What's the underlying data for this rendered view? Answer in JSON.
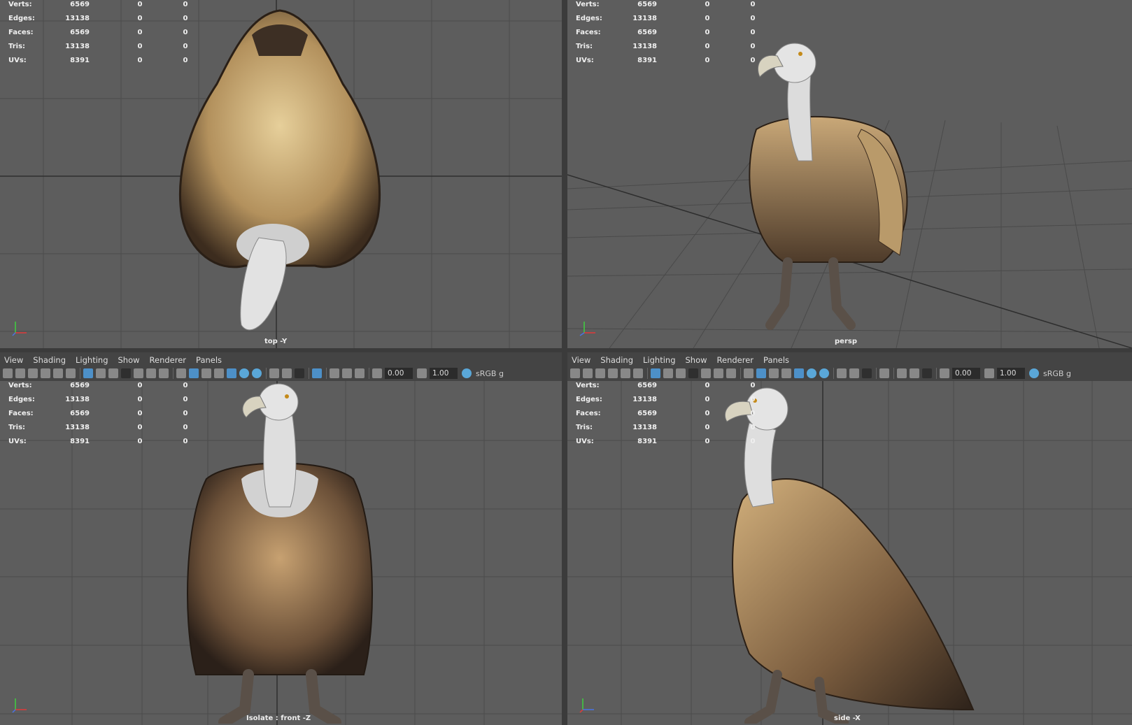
{
  "panes": [
    {
      "id": "top",
      "camera_label": "top -Y",
      "stats": [
        {
          "label": "Verts:",
          "values": [
            "6569",
            "0",
            "0"
          ]
        },
        {
          "label": "Edges:",
          "values": [
            "13138",
            "0",
            "0"
          ]
        },
        {
          "label": "Faces:",
          "values": [
            "6569",
            "0",
            "0"
          ]
        },
        {
          "label": "Tris:",
          "values": [
            "13138",
            "0",
            "0"
          ]
        },
        {
          "label": "UVs:",
          "values": [
            "8391",
            "0",
            "0"
          ]
        }
      ]
    },
    {
      "id": "persp",
      "camera_label": "persp",
      "stats": [
        {
          "label": "Verts:",
          "values": [
            "6569",
            "0",
            "0"
          ]
        },
        {
          "label": "Edges:",
          "values": [
            "13138",
            "0",
            "0"
          ]
        },
        {
          "label": "Faces:",
          "values": [
            "6569",
            "0",
            "0"
          ]
        },
        {
          "label": "Tris:",
          "values": [
            "13138",
            "0",
            "0"
          ]
        },
        {
          "label": "UVs:",
          "values": [
            "8391",
            "0",
            "0"
          ]
        }
      ]
    },
    {
      "id": "front",
      "camera_label": "Isolate : front -Z",
      "stats": [
        {
          "label": "Verts:",
          "values": [
            "6569",
            "0",
            "0"
          ]
        },
        {
          "label": "Edges:",
          "values": [
            "13138",
            "0",
            "0"
          ]
        },
        {
          "label": "Faces:",
          "values": [
            "6569",
            "0",
            "0"
          ]
        },
        {
          "label": "Tris:",
          "values": [
            "13138",
            "0",
            "0"
          ]
        },
        {
          "label": "UVs:",
          "values": [
            "8391",
            "0",
            "0"
          ]
        }
      ]
    },
    {
      "id": "side",
      "camera_label": "side -X",
      "stats": [
        {
          "label": "Verts:",
          "values": [
            "6569",
            "0",
            "0"
          ]
        },
        {
          "label": "Edges:",
          "values": [
            "13138",
            "0",
            "0"
          ]
        },
        {
          "label": "Faces:",
          "values": [
            "6569",
            "0",
            "0"
          ]
        },
        {
          "label": "Tris:",
          "values": [
            "13138",
            "0",
            "0"
          ]
        },
        {
          "label": "UVs:",
          "values": [
            "8391",
            "0",
            "0"
          ]
        }
      ]
    }
  ],
  "menus": [
    "View",
    "Shading",
    "Lighting",
    "Show",
    "Renderer",
    "Panels"
  ],
  "toolbar": {
    "exposure": "0.00",
    "gamma": "1.00",
    "color_space": "sRGB g"
  },
  "colors": {
    "viewport_bg": "#5d5d5d",
    "grid_line": "#4a4a4a",
    "grid_axis": "#2e2e2e",
    "ui_bg": "#444444"
  }
}
